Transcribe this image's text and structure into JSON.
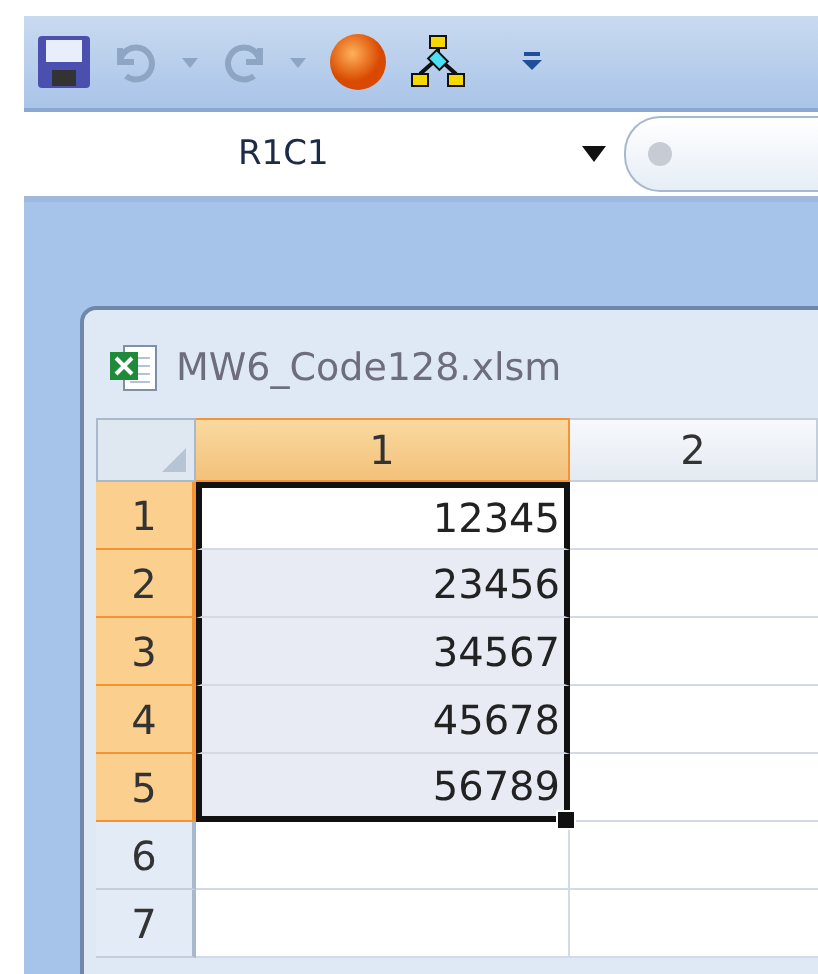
{
  "name_box": {
    "value": "R1C1"
  },
  "workbook": {
    "title": "MW6_Code128.xlsm"
  },
  "columns": [
    {
      "label": "1",
      "selected": true
    },
    {
      "label": "2",
      "selected": false
    }
  ],
  "rows": [
    {
      "label": "1",
      "selected": true,
      "value": "12345"
    },
    {
      "label": "2",
      "selected": true,
      "value": "23456"
    },
    {
      "label": "3",
      "selected": true,
      "value": "34567"
    },
    {
      "label": "4",
      "selected": true,
      "value": "45678"
    },
    {
      "label": "5",
      "selected": true,
      "value": "56789"
    },
    {
      "label": "6",
      "selected": false
    },
    {
      "label": "7",
      "selected": false
    }
  ]
}
